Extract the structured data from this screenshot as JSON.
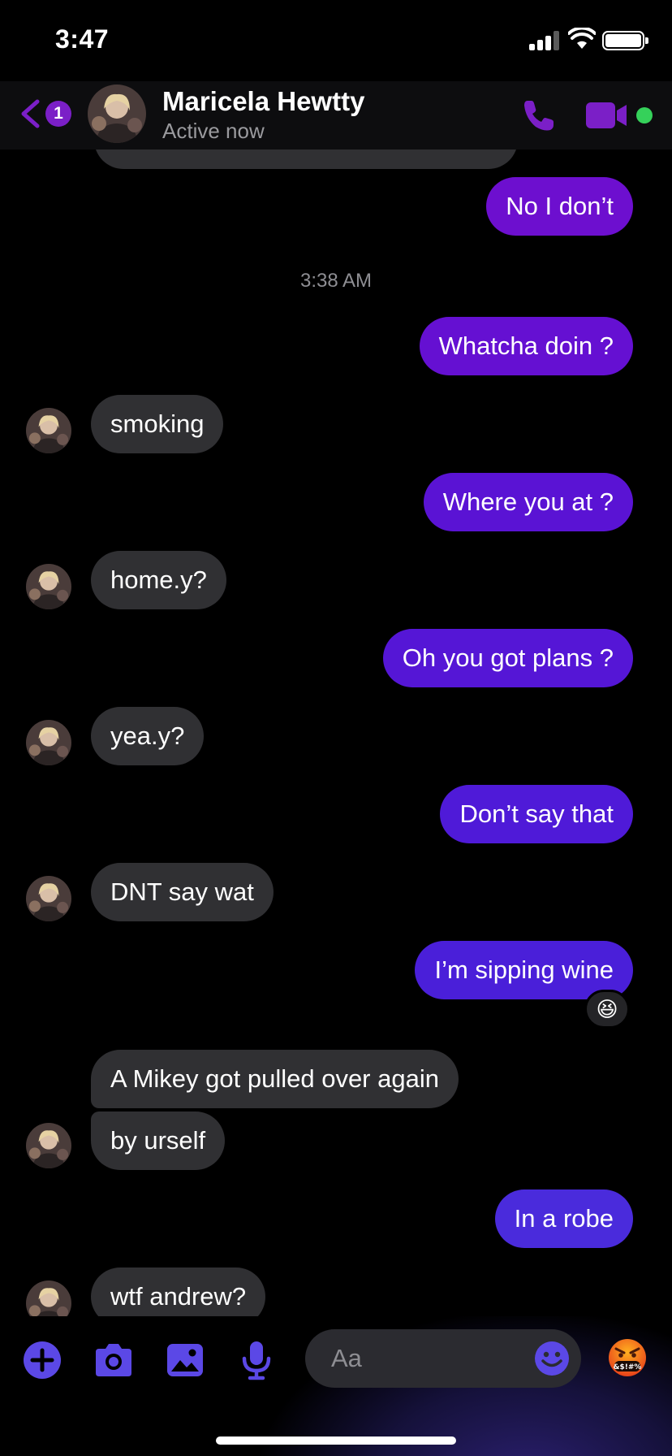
{
  "status_bar": {
    "time": "3:47"
  },
  "header": {
    "back_badge": "1",
    "contact_name": "Maricela Hewtty",
    "contact_status": "Active now",
    "accent_color": "#7b1fc7",
    "online_color": "#35d15a"
  },
  "thread": {
    "timestamp": "3:38 AM",
    "messages": [
      {
        "from": "me",
        "text": "No I don’t"
      },
      {
        "from": "me",
        "text": "Whatcha doin ?"
      },
      {
        "from": "them",
        "text": "smoking"
      },
      {
        "from": "me",
        "text": "Where you at ?"
      },
      {
        "from": "them",
        "text": "home.y?"
      },
      {
        "from": "me",
        "text": "Oh you got plans ?"
      },
      {
        "from": "them",
        "text": "yea.y?"
      },
      {
        "from": "me",
        "text": "Don’t say that"
      },
      {
        "from": "them",
        "text": "DNT say wat"
      },
      {
        "from": "me",
        "text": "I’m sipping wine",
        "reaction": "😆"
      },
      {
        "from": "them",
        "text": "A Mikey got pulled over again"
      },
      {
        "from": "them",
        "text": "by urself"
      },
      {
        "from": "me",
        "text": "In a robe"
      },
      {
        "from": "them",
        "text": "wtf andrew?"
      }
    ]
  },
  "composer": {
    "placeholder": "Aa",
    "icons": [
      "plus-icon",
      "camera-icon",
      "image-icon",
      "microphone-icon",
      "emoji-icon",
      "angry-emoji-icon"
    ]
  }
}
